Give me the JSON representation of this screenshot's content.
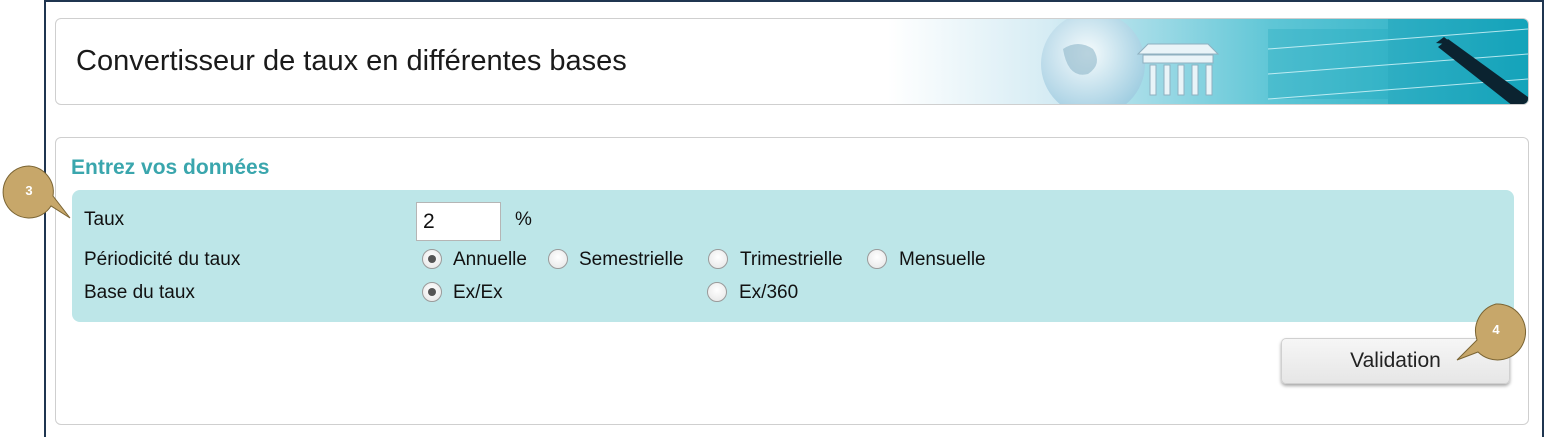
{
  "header": {
    "title": "Convertisseur de taux en différentes bases"
  },
  "form": {
    "section_title": "Entrez vos données",
    "rate_label": "Taux",
    "rate_value": "2",
    "rate_unit": "%",
    "periodicity_label": "Périodicité du taux",
    "periodicity_options": [
      "Annuelle",
      "Semestrielle",
      "Trimestrielle",
      "Mensuelle"
    ],
    "periodicity_selected": "Annuelle",
    "base_label": "Base du taux",
    "base_options": [
      "Ex/Ex",
      "Ex/360"
    ],
    "base_selected": "Ex/Ex"
  },
  "actions": {
    "validate_label": "Validation"
  },
  "callouts": [
    "3",
    "4"
  ],
  "colors": {
    "section_title": "#3aa6ad",
    "form_background": "#bde6e8",
    "callout": "#c7a76a",
    "frame_border": "#1f3550"
  }
}
